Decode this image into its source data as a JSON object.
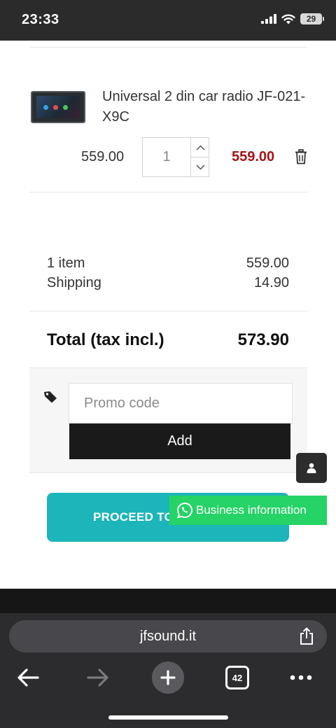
{
  "status_bar": {
    "time": "23:33",
    "battery": "29"
  },
  "cart_item": {
    "name": "Universal 2 din car radio JF-021-X9C",
    "unit_price": "559.00",
    "quantity": "1",
    "line_total": "559.00"
  },
  "summary": {
    "items_label": "1 item",
    "items_value": "559.00",
    "shipping_label": "Shipping",
    "shipping_value": "14.90",
    "total_label": "Total (tax incl.)",
    "total_value": "573.90"
  },
  "promo": {
    "placeholder": "Promo code",
    "add_label": "Add"
  },
  "checkout": {
    "label": "PROCEED TO"
  },
  "whatsapp": {
    "label": "Business information"
  },
  "browser": {
    "url": "jfsound.it",
    "tabs_count": "42"
  },
  "colors": {
    "price_accent": "#a31515",
    "checkout_button": "#1cb5b9",
    "whatsapp_green": "#25d366",
    "status_bar": "#2b2b2b",
    "browser_chrome": "#2c2c2e"
  },
  "icons": [
    "signal-icon",
    "wifi-icon",
    "battery-icon",
    "chevron-up-icon",
    "chevron-down-icon",
    "trash-icon",
    "tag-icon",
    "user-icon",
    "whatsapp-icon",
    "share-icon",
    "back-arrow-icon",
    "forward-arrow-icon",
    "plus-icon",
    "tabs-icon",
    "more-icon"
  ]
}
